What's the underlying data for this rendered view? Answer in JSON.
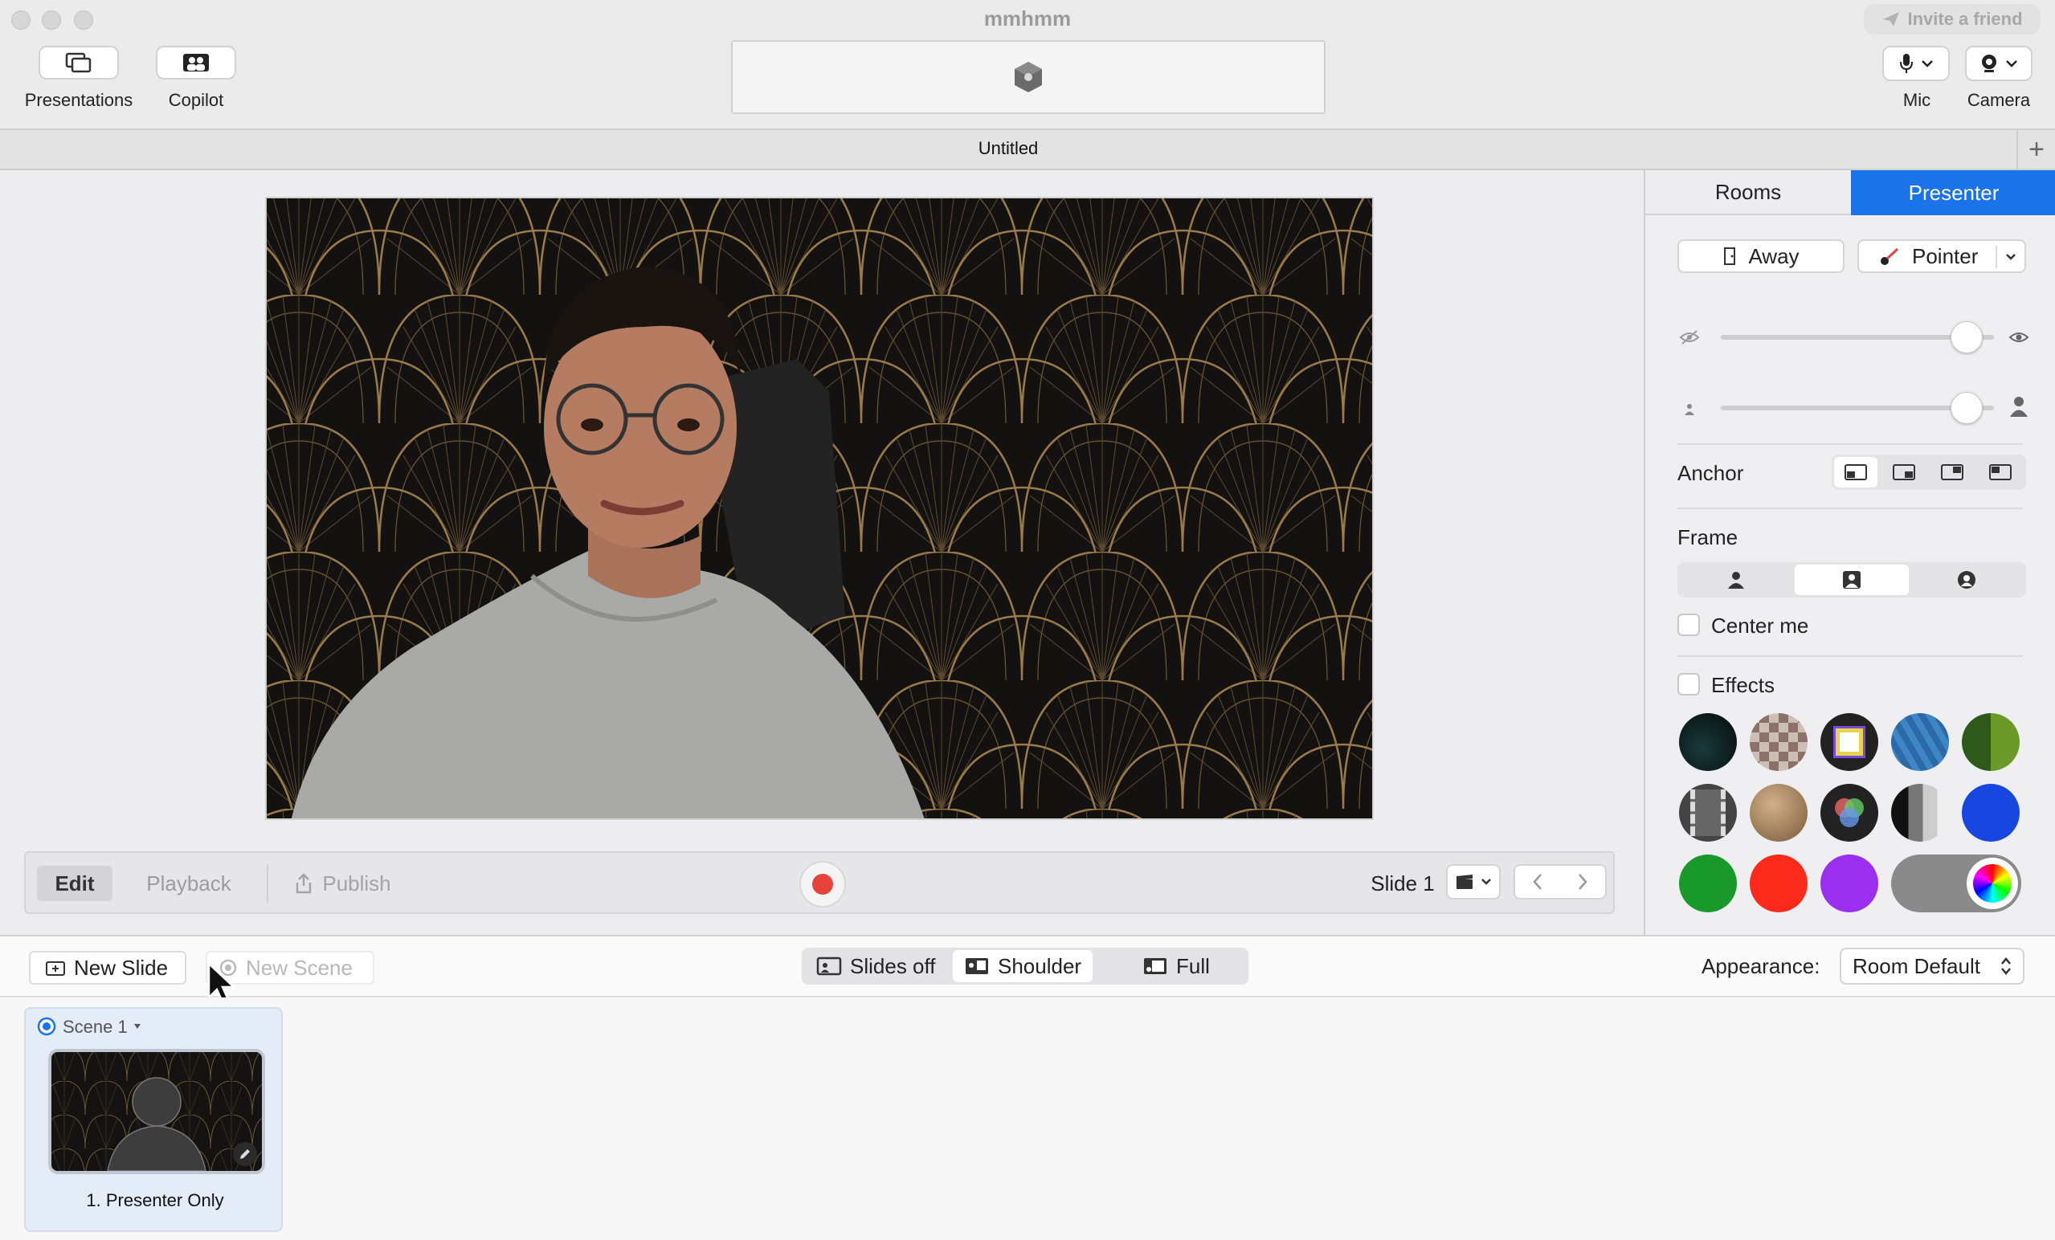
{
  "window": {
    "title": "mmhmm"
  },
  "toolbar": {
    "presentations_label": "Presentations",
    "copilot_label": "Copilot",
    "invite_label": "Invite a friend",
    "mic_label": "Mic",
    "camera_label": "Camera"
  },
  "document": {
    "tab_title": "Untitled"
  },
  "controls": {
    "edit_label": "Edit",
    "playback_label": "Playback",
    "publish_label": "Publish",
    "slide_label": "Slide 1"
  },
  "panel": {
    "tabs": [
      "Rooms",
      "Presenter"
    ],
    "active_tab": "Presenter",
    "away_label": "Away",
    "pointer_label": "Pointer",
    "opacity_level": 0.9,
    "size_level": 0.9,
    "anchor_label": "Anchor",
    "frame_label": "Frame",
    "center_me_label": "Center me",
    "center_me_checked": false,
    "effects_label": "Effects",
    "effects_checked": false,
    "accent_color": "#1a73e8"
  },
  "bottom": {
    "new_slide_label": "New Slide",
    "new_scene_label": "New Scene",
    "view_options": [
      "Slides off",
      "Shoulder",
      "Full"
    ],
    "view_selected": "Shoulder",
    "appearance_label": "Appearance:",
    "appearance_value": "Room Default"
  },
  "scenes": {
    "scene_name": "Scene 1",
    "slide_caption": "1. Presenter Only"
  }
}
